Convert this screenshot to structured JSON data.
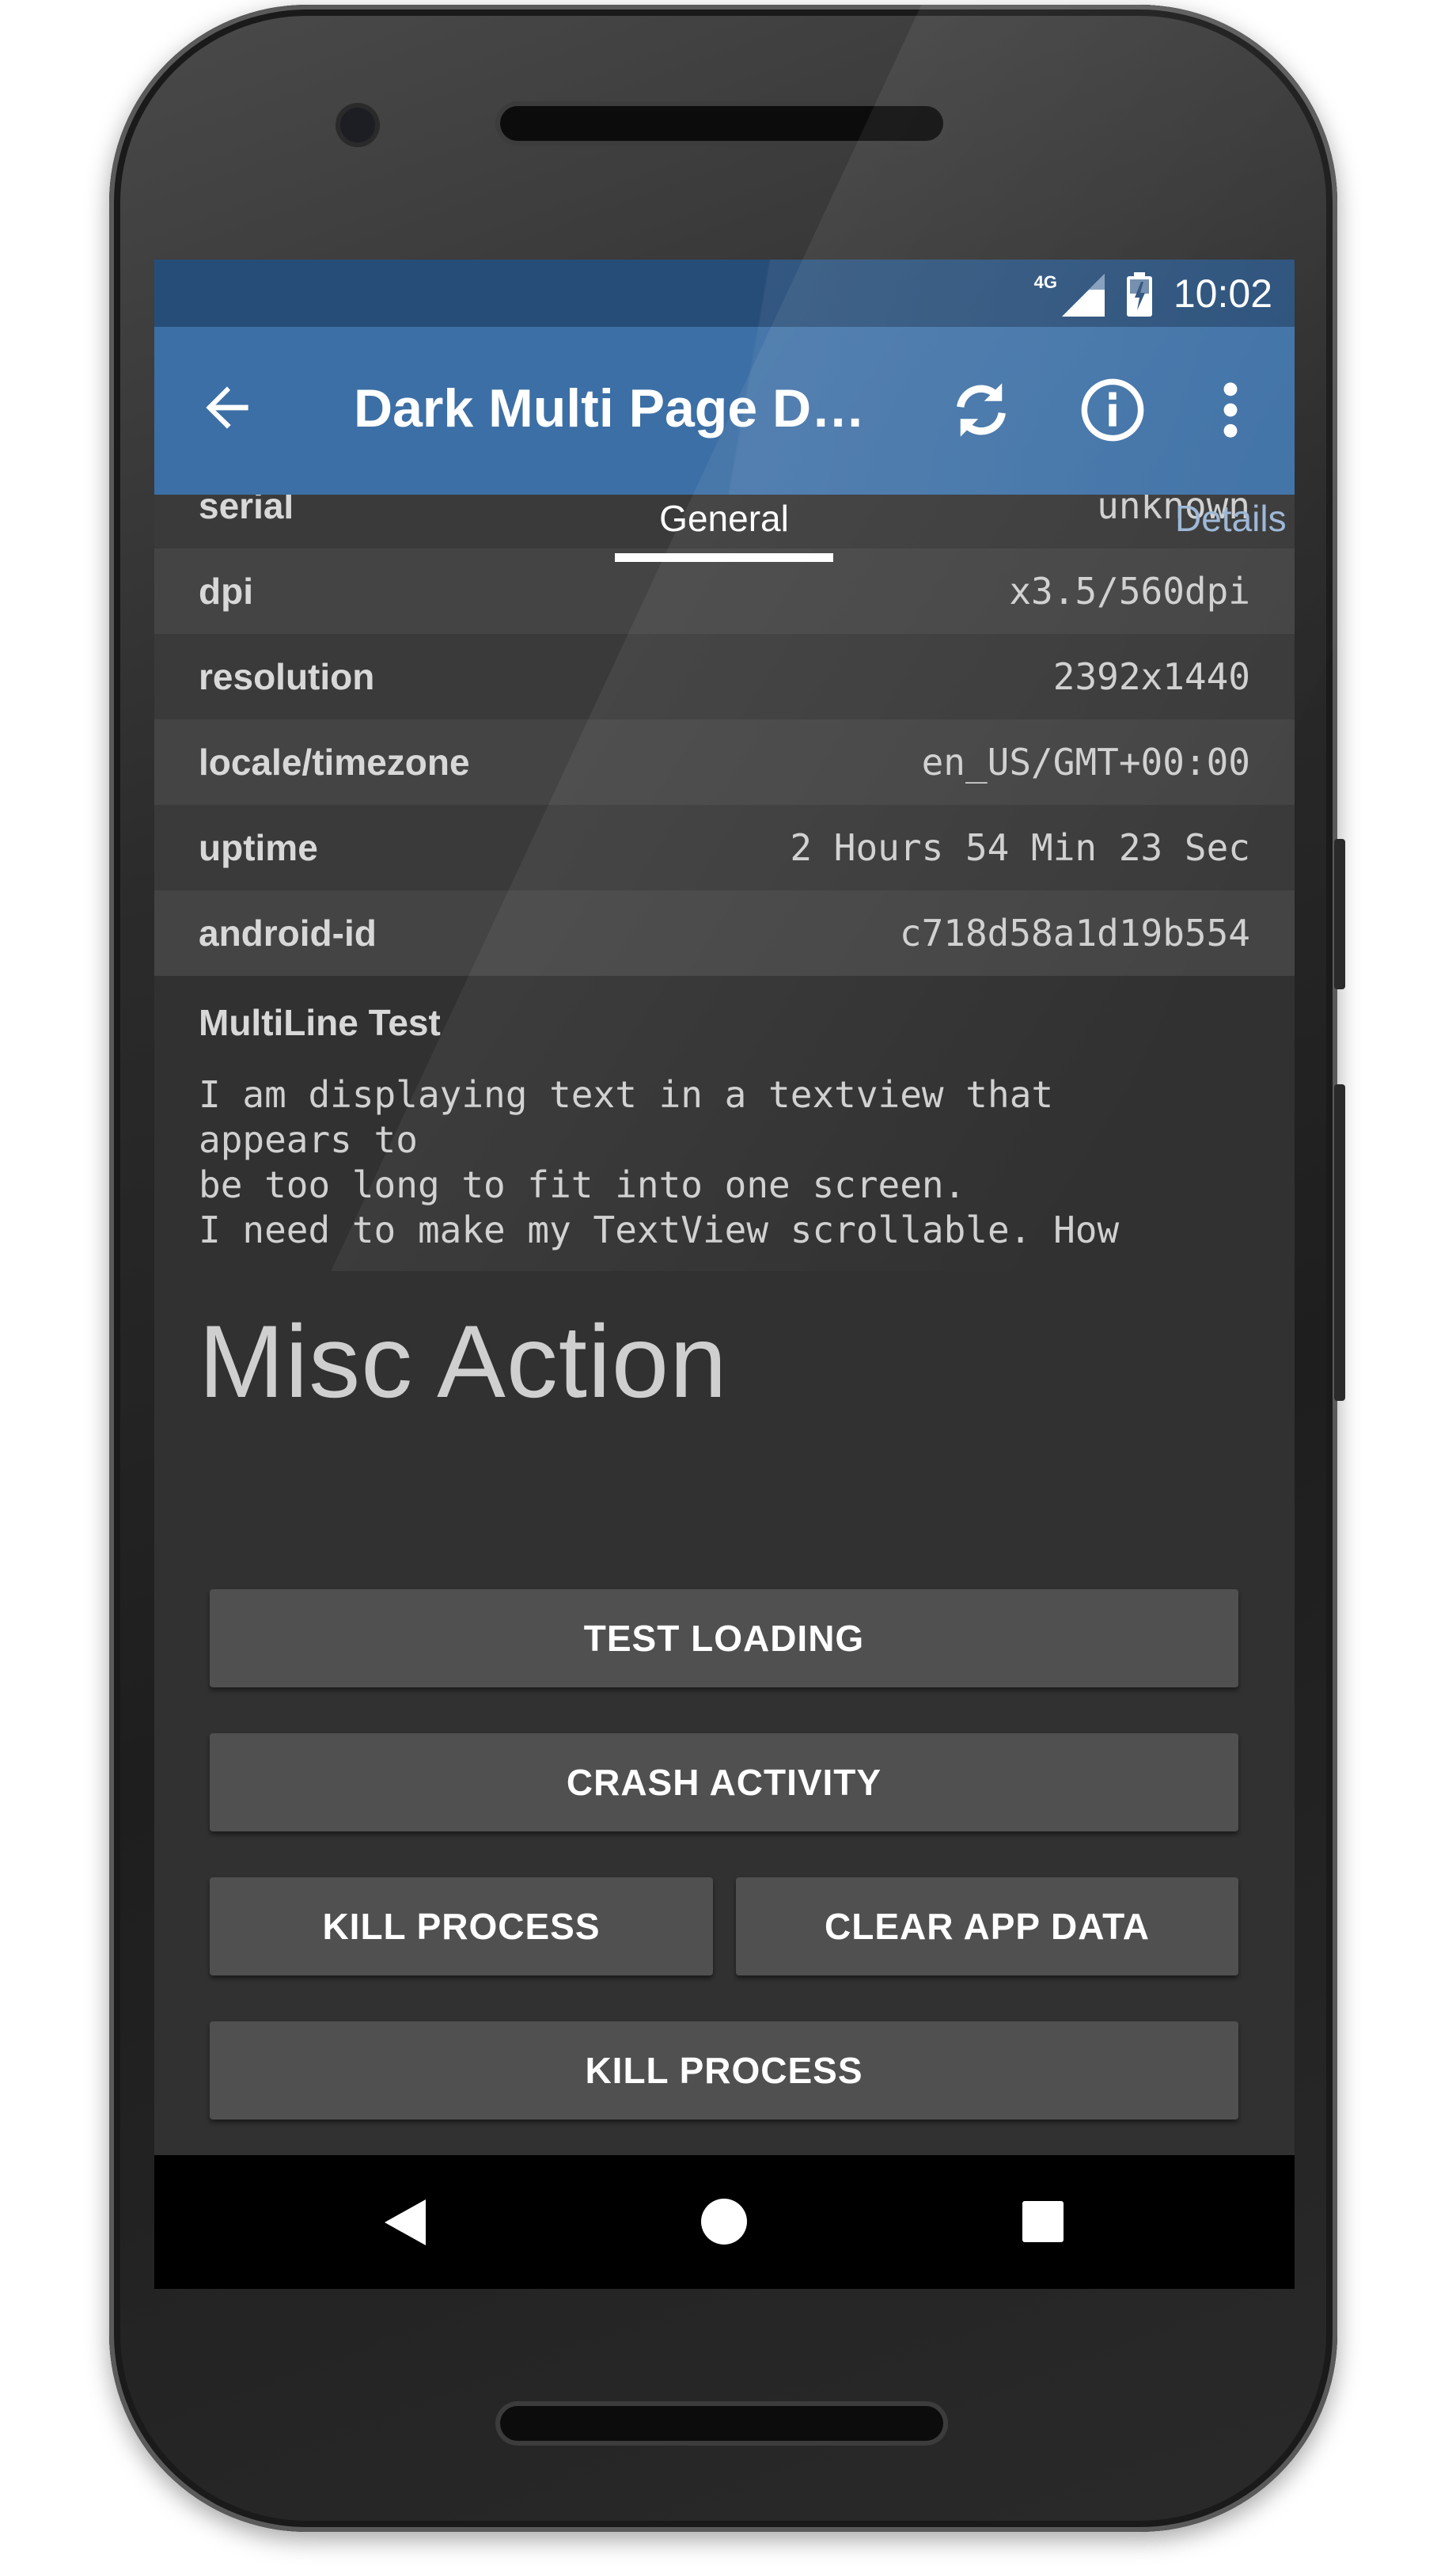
{
  "status_bar": {
    "time": "10:02",
    "network_type": "4G"
  },
  "app_bar": {
    "title": "Dark Multi Page De…",
    "back_icon": "arrow-back-icon",
    "actions": [
      "refresh-icon",
      "info-icon",
      "more-vert-icon"
    ],
    "color": "#3c6fa5"
  },
  "tabs": [
    {
      "label": "General",
      "selected": true
    },
    {
      "label": "Details",
      "selected": false
    }
  ],
  "info_rows": [
    {
      "key": "serial",
      "value": "unknown"
    },
    {
      "key": "dpi",
      "value": "x3.5/560dpi"
    },
    {
      "key": "resolution",
      "value": "2392x1440"
    },
    {
      "key": "locale/timezone",
      "value": "en_US/GMT+00:00"
    },
    {
      "key": "uptime",
      "value": "2 Hours 54 Min 23 Sec"
    },
    {
      "key": "android-id",
      "value": "c718d58a1d19b554"
    }
  ],
  "multiline": {
    "title": "MultiLine Test",
    "body": "I am displaying text in a textview that\nappears to\nbe too long to fit into one screen.\nI need to make my TextView scrollable. How"
  },
  "misc": {
    "heading": "Misc Action",
    "buttons": {
      "test_loading": "TEST LOADING",
      "crash_activity": "CRASH ACTIVITY",
      "kill_process": "KILL PROCESS",
      "clear_app_data": "CLEAR APP DATA",
      "kill_process_2": "KILL PROCESS"
    }
  },
  "nav_bar": {
    "icons": [
      "nav-back-icon",
      "nav-home-icon",
      "nav-recents-icon"
    ]
  }
}
